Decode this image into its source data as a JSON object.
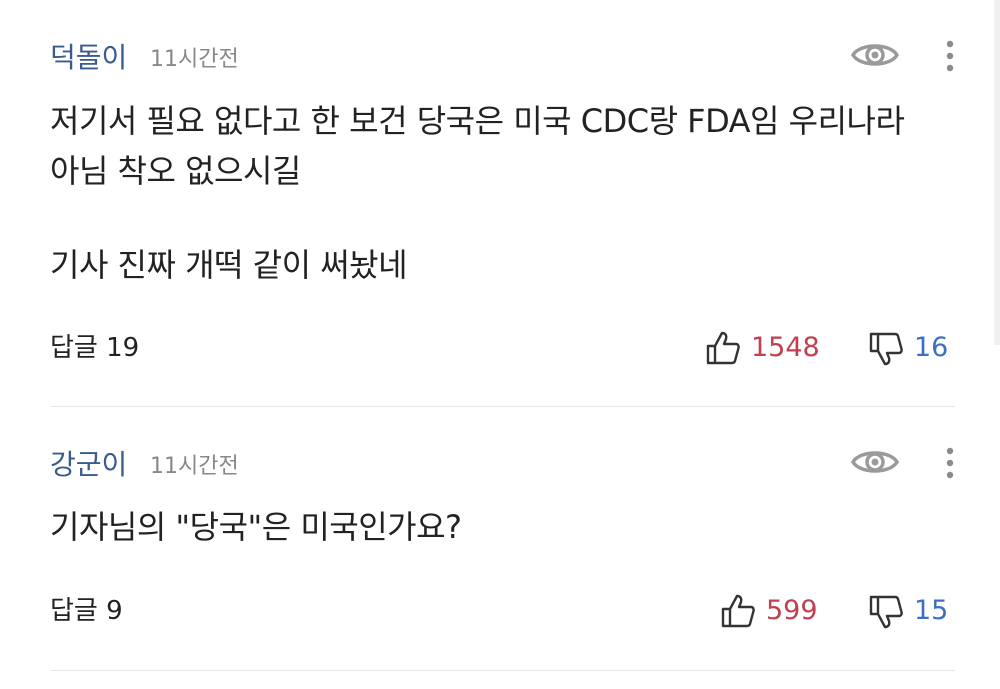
{
  "comments": [
    {
      "author": "덕돌이",
      "time": "11시간전",
      "body": [
        "저기서 필요 없다고 한 보건 당국은 미국 CDC랑 FDA임 우리나라",
        "아님 착오 없으시길",
        "",
        "기사 진짜 개떡 같이 써놨네"
      ],
      "reply_label": "답글 19",
      "likes": "1548",
      "dislikes": "16"
    },
    {
      "author": "강군이",
      "time": "11시간전",
      "body": [
        "기자님의 \"당국\"은 미국인가요?"
      ],
      "reply_label": "답글 9",
      "likes": "599",
      "dislikes": "15"
    }
  ],
  "icons": {
    "view": "eye-icon",
    "more": "more-vertical-icon",
    "like": "thumbs-up-icon",
    "dislike": "thumbs-down-icon"
  },
  "colors": {
    "author": "#3a5b8f",
    "like_count": "#c0404e",
    "dislike_count": "#3f6fc4",
    "divider": "#e6e6e6"
  }
}
